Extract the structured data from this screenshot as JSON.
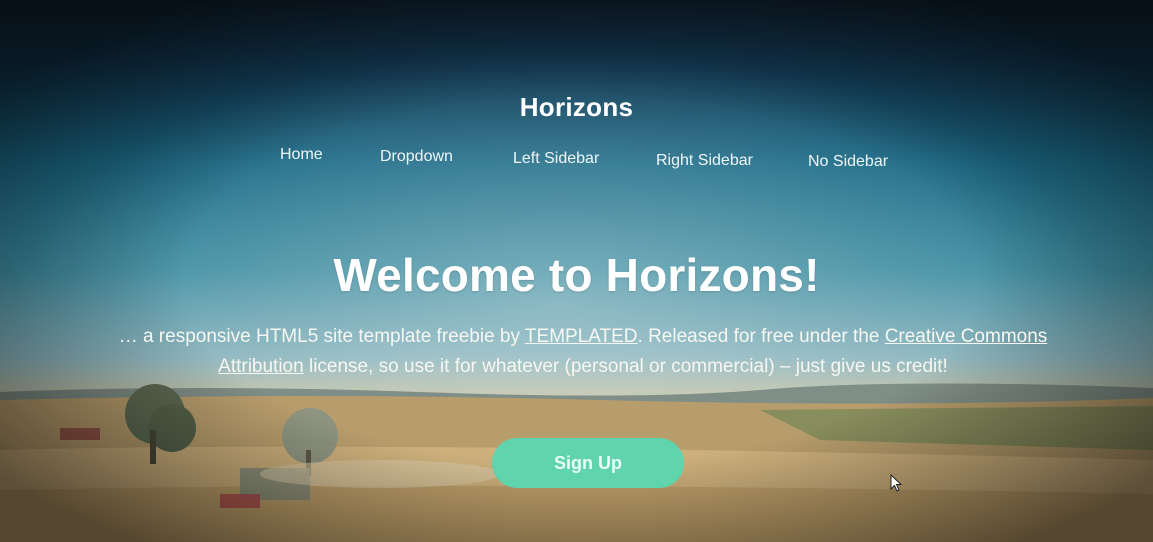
{
  "site": {
    "title": "Horizons"
  },
  "nav": {
    "items": [
      {
        "label": "Home"
      },
      {
        "label": "Dropdown"
      },
      {
        "label": "Left Sidebar"
      },
      {
        "label": "Right Sidebar"
      },
      {
        "label": "No Sidebar"
      }
    ]
  },
  "hero": {
    "headline": "Welcome to Horizons!",
    "tagline": {
      "part1": "… a responsive HTML5 site template freebie by ",
      "link1": "TEMPLATED",
      "part2": ". Released for free under the ",
      "link2": "Creative Commons Attribution",
      "part3": " license, so use it for whatever (personal or commercial) – just give us credit!"
    },
    "signup_label": "Sign Up"
  },
  "colors": {
    "sky_top": "#10202f",
    "sky_mid": "#1b6a86",
    "field": "#c8aa76",
    "button": "#5fd4ad"
  },
  "icons": {
    "cursor": "arrow-cursor-icon"
  }
}
